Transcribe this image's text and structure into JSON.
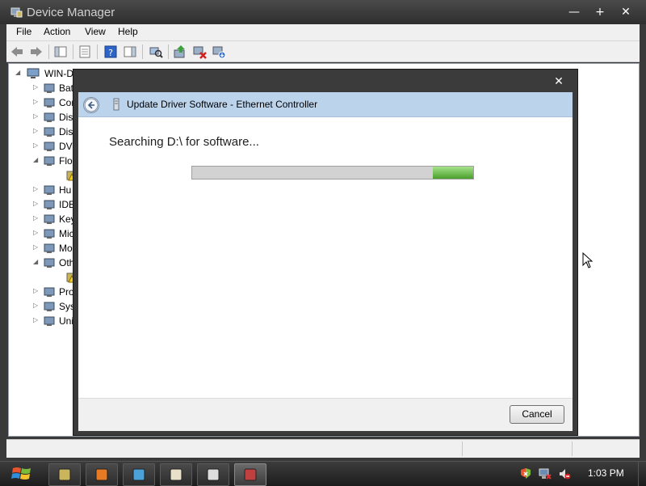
{
  "window": {
    "title": "Device Manager",
    "minimize_glyph": "—",
    "maximize_glyph": "+",
    "close_glyph": "✕"
  },
  "menu": {
    "file": "File",
    "action": "Action",
    "view": "View",
    "help": "Help"
  },
  "toolbar": {
    "icons": [
      "back-icon",
      "forward-icon",
      "show-hide-console-tree-icon",
      "properties-icon",
      "help-icon",
      "show-hide-action-pane-icon",
      "scan-hardware-icon",
      "update-driver-icon",
      "uninstall-icon",
      "disable-icon"
    ]
  },
  "tree": {
    "root": "WIN-D",
    "items": [
      {
        "label": "Bat",
        "icon": "battery-icon",
        "expander": "▷"
      },
      {
        "label": "Cor",
        "icon": "computer-icon",
        "expander": "▷"
      },
      {
        "label": "Dis",
        "icon": "disk-drive-icon",
        "expander": "▷"
      },
      {
        "label": "Dis",
        "icon": "display-adapter-icon",
        "expander": "▷"
      },
      {
        "label": "DVI",
        "icon": "dvd-drive-icon",
        "expander": "▷"
      },
      {
        "label": "Flo",
        "icon": "floppy-controller-icon",
        "expander": "◢"
      },
      {
        "label": "",
        "icon": "floppy-warning-icon",
        "expander": ""
      },
      {
        "label": "Hu",
        "icon": "hid-icon",
        "expander": "▷"
      },
      {
        "label": "IDE",
        "icon": "ide-controller-icon",
        "expander": "▷"
      },
      {
        "label": "Key",
        "icon": "keyboard-icon",
        "expander": "▷"
      },
      {
        "label": "Mic",
        "icon": "mouse-icon",
        "expander": "▷"
      },
      {
        "label": "Mo",
        "icon": "monitor-icon",
        "expander": "▷"
      },
      {
        "label": "Oth",
        "icon": "other-devices-icon",
        "expander": "◢"
      },
      {
        "label": "",
        "icon": "unknown-device-warning-icon",
        "expander": ""
      },
      {
        "label": "Pro",
        "icon": "processor-icon",
        "expander": "▷"
      },
      {
        "label": "Sys",
        "icon": "system-devices-icon",
        "expander": "▷"
      },
      {
        "label": "Uni",
        "icon": "usb-controller-icon",
        "expander": "▷"
      }
    ]
  },
  "dialog": {
    "close_glyph": "✕",
    "title": "Update Driver Software - Ethernet Controller",
    "status_text": "Searching D:\\ for software...",
    "progress": {
      "track_fraction_start": 0.857,
      "track_fraction_end": 1.0
    },
    "cancel_label": "Cancel"
  },
  "taskbar": {
    "items": [
      {
        "icon": "device-manager-taskbar-icon"
      },
      {
        "icon": "firefox-icon"
      },
      {
        "icon": "network-users-icon"
      },
      {
        "icon": "notepad-icon"
      },
      {
        "icon": "window-icon"
      },
      {
        "icon": "computer-management-icon",
        "active": true
      }
    ],
    "tray": [
      "action-center-icon",
      "network-icon",
      "volume-muted-icon"
    ],
    "clock": "1:03 PM"
  },
  "colors": {
    "dialog_header": "#bcd3ec",
    "progress_green": "#5cb83a"
  }
}
